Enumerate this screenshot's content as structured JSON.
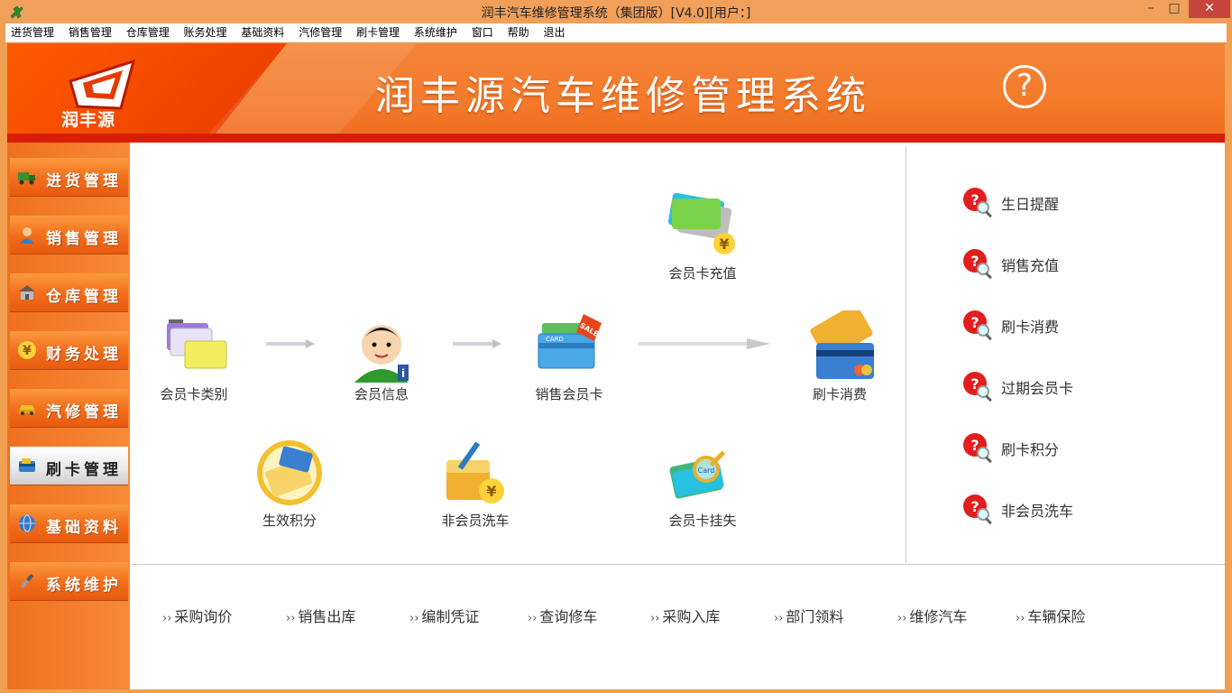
{
  "window": {
    "title": "润丰汽车维修管理系统（集团版）[V4.0][用户：]",
    "minimize": "–",
    "maximize": "□",
    "close": "✕"
  },
  "menu": [
    "进货管理",
    "销售管理",
    "仓库管理",
    "账务处理",
    "基础资料",
    "汽修管理",
    "刷卡管理",
    "系统维护",
    "窗口",
    "帮助",
    "退出"
  ],
  "banner": {
    "logo_text": "润丰源",
    "title": "润丰源汽车维修管理系统",
    "help_icon": "?"
  },
  "sidebar": {
    "items": [
      {
        "label": "进货管理",
        "icon": "truck-icon",
        "color": "#3b8f2e"
      },
      {
        "label": "销售管理",
        "icon": "user-icon",
        "color": "#2f7fd0"
      },
      {
        "label": "仓库管理",
        "icon": "warehouse-icon",
        "color": "#7b6b5a"
      },
      {
        "label": "财务处理",
        "icon": "yen-icon",
        "color": "#e6b400"
      },
      {
        "label": "汽修管理",
        "icon": "car-icon",
        "color": "#f0c020"
      },
      {
        "label": "刷卡管理",
        "icon": "card-icon",
        "color": "#2f7fd0"
      },
      {
        "label": "基础资料",
        "icon": "globe-icon",
        "color": "#3a78c8"
      },
      {
        "label": "系统维护",
        "icon": "tools-icon",
        "color": "#7a7a7a"
      }
    ],
    "active_index": 5
  },
  "flow": {
    "member_card_type": "会员卡类别",
    "member_info": "会员信息",
    "sell_member_card": "销售会员卡",
    "member_card_topup": "会员卡充值",
    "card_consume": "刷卡消费",
    "effective_points": "生效积分",
    "non_member_wash": "非会员洗车",
    "member_card_lost": "会员卡挂失"
  },
  "quick_links": [
    "生日提醒",
    "销售充值",
    "刷卡消费",
    "过期会员卡",
    "刷卡积分",
    "非会员洗车"
  ],
  "bottom_links": [
    "采购询价",
    "销售出库",
    "编制凭证",
    "查询修车",
    "采购入库",
    "部门领料",
    "维修汽车",
    "车辆保险"
  ],
  "colors": {
    "accent": "#f47a2a",
    "banner_red": "#d81e06",
    "close_button": "#c7453b"
  }
}
